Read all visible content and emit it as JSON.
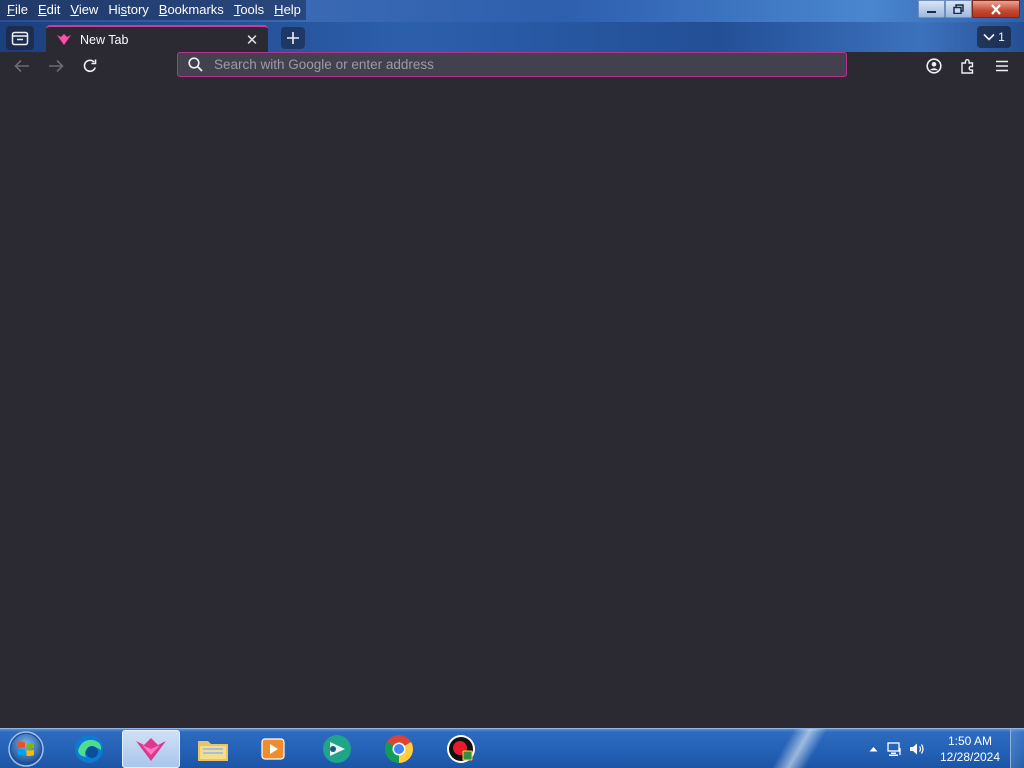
{
  "menu": {
    "items": [
      {
        "label": "File",
        "accel": "F",
        "rest": "ile"
      },
      {
        "label": "Edit",
        "accel": "E",
        "rest": "dit"
      },
      {
        "label": "View",
        "accel": "V",
        "rest": "iew"
      },
      {
        "label": "History",
        "accel": "",
        "pre": "Hi",
        "accel2": "s",
        "rest": "tory"
      },
      {
        "label": "Bookmarks",
        "accel": "B",
        "rest": "ookmarks"
      },
      {
        "label": "Tools",
        "accel": "T",
        "rest": "ools"
      },
      {
        "label": "Help",
        "accel": "H",
        "rest": "elp"
      }
    ]
  },
  "tabs": {
    "active": {
      "title": "New Tab",
      "close_glyph": "✕"
    },
    "new_tab_glyph": "+",
    "list_count": "1"
  },
  "nav": {
    "back_icon": "arrow-left-icon",
    "forward_icon": "arrow-right-icon",
    "reload_icon": "reload-icon"
  },
  "urlbar": {
    "placeholder": "Search with Google or enter address",
    "value": ""
  },
  "taskbar": {
    "apps": [
      "edge-icon",
      "browser-icon",
      "file-explorer-icon",
      "media-player-icon",
      "app-icon",
      "chrome-icon",
      "recorder-icon"
    ],
    "clock": {
      "time": "1:50 AM",
      "date": "12/28/2024"
    }
  },
  "colors": {
    "accent": "#b8338f",
    "browser_bg": "#2b2a33",
    "taskbar": "#2563b8"
  }
}
